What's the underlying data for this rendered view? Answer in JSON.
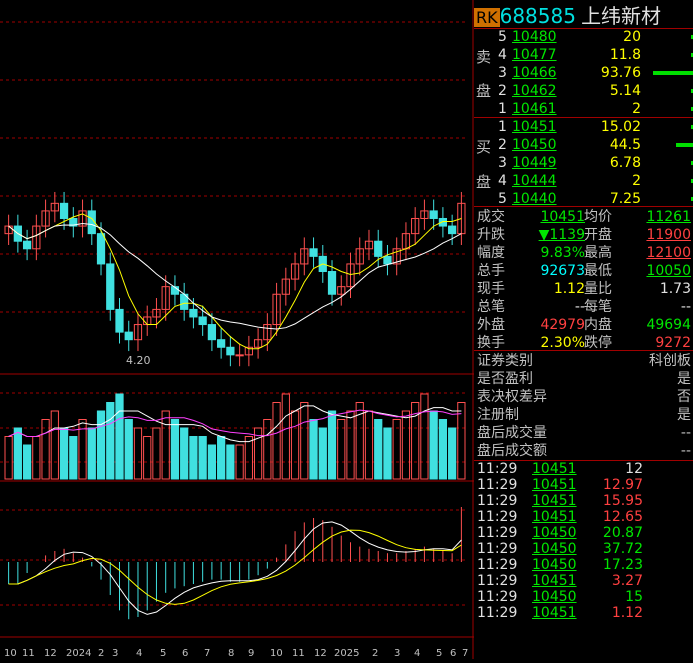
{
  "header": {
    "badge": "RK",
    "code": "688585",
    "name": "上纬新材"
  },
  "colors": {
    "up": "#ff4040",
    "down": "#00e600",
    "neutral": "#e0e0e0",
    "grid": "#a00000",
    "volume_up": "#ff5050",
    "volume_down": "#40e0e0",
    "ma_white": "#ffffff",
    "ma_yellow": "#ffff00",
    "ma_magenta": "#ff40ff"
  },
  "order_book": {
    "sell_label_1": "卖",
    "sell_label_2": "盘",
    "buy_label_1": "买",
    "buy_label_2": "盘",
    "asks": [
      {
        "level": "5",
        "price": "10480",
        "volume": "20",
        "bar": 0.03
      },
      {
        "level": "4",
        "price": "10477",
        "volume": "11.8",
        "bar": 0.02
      },
      {
        "level": "3",
        "price": "10466",
        "volume": "93.76",
        "bar": 0.95
      },
      {
        "level": "2",
        "price": "10462",
        "volume": "5.14",
        "bar": 0.02
      },
      {
        "level": "1",
        "price": "10461",
        "volume": "2",
        "bar": 0.01
      }
    ],
    "bids": [
      {
        "level": "1",
        "price": "10451",
        "volume": "15.02",
        "bar": 0.05
      },
      {
        "level": "2",
        "price": "10450",
        "volume": "44.5",
        "bar": 0.4
      },
      {
        "level": "3",
        "price": "10449",
        "volume": "6.78",
        "bar": 0.03
      },
      {
        "level": "4",
        "price": "10444",
        "volume": "2",
        "bar": 0.02
      },
      {
        "level": "5",
        "price": "10440",
        "volume": "7.25",
        "bar": 0.04
      }
    ]
  },
  "stats": [
    {
      "l1": "成交",
      "v1": "10451",
      "l2": "均价",
      "v2": "11261"
    },
    {
      "l1": "升跌",
      "v1": "▼1139",
      "l2": "开盘",
      "v2": "11900"
    },
    {
      "l1": "幅度",
      "v1": "9.83%",
      "l2": "最高",
      "v2": "12100"
    },
    {
      "l1": "总手",
      "v1": "92673",
      "l2": "最低",
      "v2": "10050"
    },
    {
      "l1": "现手",
      "v1": "1.12",
      "l2": "量比",
      "v2": "1.73"
    },
    {
      "l1": "总笔",
      "v1": "--",
      "l2": "每笔",
      "v2": "--"
    },
    {
      "l1": "外盘",
      "v1": "42979",
      "l2": "内盘",
      "v2": "49694"
    },
    {
      "l1": "换手",
      "v1": "2.30%",
      "l2": "跌停",
      "v2": "9272"
    }
  ],
  "info": [
    {
      "label": "证券类别",
      "value": "科创板"
    },
    {
      "label": "是否盈利",
      "value": "是"
    },
    {
      "label": "表决权差异",
      "value": "否"
    },
    {
      "label": "注册制",
      "value": "是"
    },
    {
      "label": "盘后成交量",
      "value": "--"
    },
    {
      "label": "盘后成交额",
      "value": "--"
    }
  ],
  "ticks": [
    {
      "time": "11:29",
      "price": "10451",
      "volume": "12",
      "dir": "neutral"
    },
    {
      "time": "11:29",
      "price": "10451",
      "volume": "12.97",
      "dir": "up"
    },
    {
      "time": "11:29",
      "price": "10451",
      "volume": "15.95",
      "dir": "up"
    },
    {
      "time": "11:29",
      "price": "10451",
      "volume": "12.65",
      "dir": "up"
    },
    {
      "time": "11:29",
      "price": "10450",
      "volume": "20.87",
      "dir": "down"
    },
    {
      "time": "11:29",
      "price": "10450",
      "volume": "37.72",
      "dir": "down"
    },
    {
      "time": "11:29",
      "price": "10450",
      "volume": "17.23",
      "dir": "down"
    },
    {
      "time": "11:29",
      "price": "10451",
      "volume": "3.27",
      "dir": "up"
    },
    {
      "time": "11:29",
      "price": "10450",
      "volume": "15",
      "dir": "down"
    },
    {
      "time": "11:29",
      "price": "10451",
      "volume": "1.12",
      "dir": "up"
    }
  ],
  "chart": {
    "low_label": "4.20",
    "x_labels": [
      "10",
      "11",
      "12",
      "2024",
      "2",
      "3",
      "4",
      "5",
      "6",
      "7",
      "8",
      "9",
      "10",
      "11",
      "12",
      "2025",
      "2",
      "3",
      "4",
      "5",
      "6",
      "7"
    ]
  },
  "chart_data": {
    "type": "candlestick",
    "price": {
      "open": [
        6.0,
        6.1,
        5.9,
        5.8,
        6.1,
        6.3,
        6.4,
        6.2,
        6.1,
        6.3,
        6.0,
        5.6,
        5.0,
        4.7,
        4.6,
        4.8,
        4.9,
        5.0,
        5.3,
        5.2,
        5.0,
        4.9,
        4.8,
        4.6,
        4.5,
        4.4,
        4.4,
        4.5,
        4.6,
        4.8,
        5.2,
        5.4,
        5.6,
        5.8,
        5.7,
        5.5,
        5.2,
        5.3,
        5.6,
        5.8,
        5.9,
        5.7,
        5.6,
        5.8,
        6.0,
        6.2,
        6.3,
        6.2,
        6.1,
        6.0
      ],
      "close": [
        6.1,
        5.9,
        5.8,
        6.1,
        6.3,
        6.4,
        6.2,
        6.1,
        6.3,
        6.0,
        5.6,
        5.0,
        4.7,
        4.6,
        4.8,
        4.9,
        5.0,
        5.3,
        5.2,
        5.0,
        4.9,
        4.8,
        4.6,
        4.5,
        4.4,
        4.4,
        4.5,
        4.6,
        4.8,
        5.2,
        5.4,
        5.6,
        5.8,
        5.7,
        5.5,
        5.2,
        5.3,
        5.6,
        5.8,
        5.9,
        5.7,
        5.6,
        5.8,
        6.0,
        6.2,
        6.3,
        6.2,
        6.1,
        6.0,
        6.4
      ],
      "ylim": [
        4.2,
        7.5
      ]
    },
    "volume": [
      5,
      6,
      4,
      5,
      7,
      8,
      6,
      5,
      7,
      6,
      8,
      9,
      10,
      7,
      6,
      5,
      6,
      8,
      7,
      6,
      5,
      5,
      4,
      5,
      4,
      4,
      5,
      6,
      7,
      9,
      10,
      8,
      9,
      7,
      6,
      8,
      7,
      8,
      9,
      8,
      7,
      6,
      7,
      8,
      9,
      10,
      8,
      7,
      6,
      9
    ],
    "macd": [
      -1,
      -1,
      -0.5,
      0,
      0.3,
      0.5,
      0.6,
      0.4,
      0.2,
      -0.2,
      -0.8,
      -1.5,
      -2.2,
      -2.6,
      -2.5,
      -2.2,
      -1.8,
      -1.4,
      -1.2,
      -1.1,
      -1.0,
      -0.9,
      -0.8,
      -0.8,
      -0.9,
      -0.9,
      -0.8,
      -0.6,
      -0.3,
      0.2,
      0.8,
      1.4,
      1.8,
      2.0,
      1.9,
      1.6,
      1.2,
      0.9,
      0.7,
      0.6,
      0.5,
      0.4,
      0.4,
      0.5,
      0.6,
      0.7,
      0.6,
      0.5,
      0.4,
      2.5
    ]
  }
}
